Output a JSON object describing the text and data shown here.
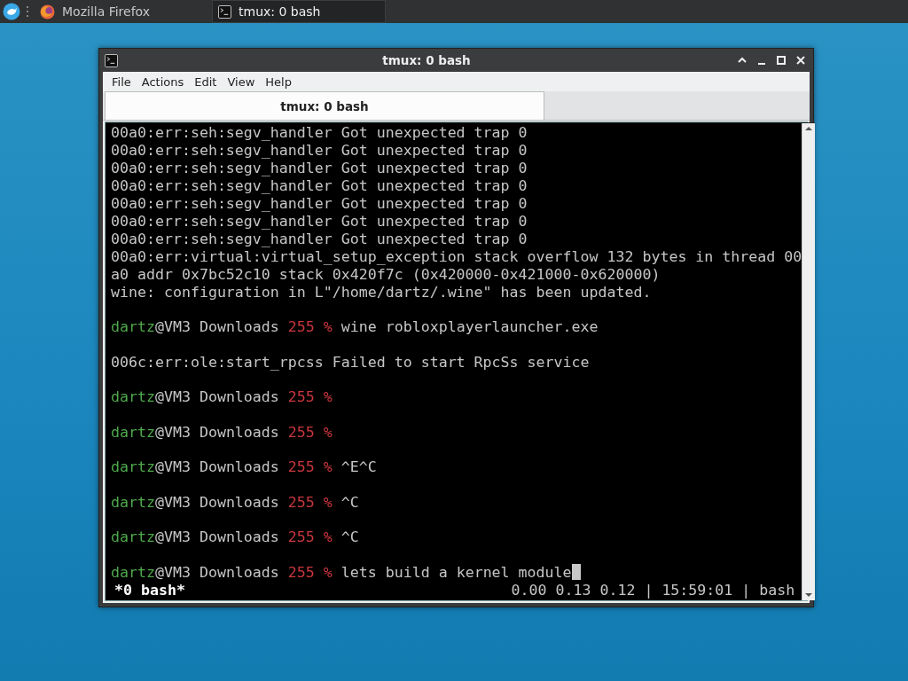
{
  "taskbar": {
    "tasks": [
      {
        "kind": "browser",
        "label": "Mozilla Firefox",
        "selected": false
      },
      {
        "kind": "terminal",
        "label": "tmux: 0 bash",
        "selected": true
      }
    ]
  },
  "window": {
    "title": "tmux: 0 bash",
    "menu": [
      "File",
      "Actions",
      "Edit",
      "View",
      "Help"
    ],
    "tabs": [
      {
        "label": "tmux: 0 bash",
        "selected": true
      }
    ],
    "terminal": {
      "lines": [
        {
          "kind": "plain",
          "text": "00a0:err:seh:segv_handler Got unexpected trap 0"
        },
        {
          "kind": "plain",
          "text": "00a0:err:seh:segv_handler Got unexpected trap 0"
        },
        {
          "kind": "plain",
          "text": "00a0:err:seh:segv_handler Got unexpected trap 0"
        },
        {
          "kind": "plain",
          "text": "00a0:err:seh:segv_handler Got unexpected trap 0"
        },
        {
          "kind": "plain",
          "text": "00a0:err:seh:segv_handler Got unexpected trap 0"
        },
        {
          "kind": "plain",
          "text": "00a0:err:seh:segv_handler Got unexpected trap 0"
        },
        {
          "kind": "plain",
          "text": "00a0:err:seh:segv_handler Got unexpected trap 0"
        },
        {
          "kind": "plain",
          "text": "00a0:err:virtual:virtual_setup_exception stack overflow 132 bytes in thread 00"
        },
        {
          "kind": "plain",
          "text": "a0 addr 0x7bc52c10 stack 0x420f7c (0x420000-0x421000-0x620000)"
        },
        {
          "kind": "plain",
          "text": "wine: configuration in L\"/home/dartz/.wine\" has been updated."
        },
        {
          "kind": "blank"
        },
        {
          "kind": "prompt",
          "user": "dartz",
          "location": "@VM3 Downloads",
          "status": "255 %",
          "command": "wine robloxplayerlauncher.exe",
          "cursor": false
        },
        {
          "kind": "blank"
        },
        {
          "kind": "plain",
          "text": "006c:err:ole:start_rpcss Failed to start RpcSs service"
        },
        {
          "kind": "blank"
        },
        {
          "kind": "prompt",
          "user": "dartz",
          "location": "@VM3 Downloads",
          "status": "255 %",
          "cursor": false
        },
        {
          "kind": "blank"
        },
        {
          "kind": "prompt",
          "user": "dartz",
          "location": "@VM3 Downloads",
          "status": "255 %",
          "cursor": false
        },
        {
          "kind": "blank"
        },
        {
          "kind": "prompt",
          "user": "dartz",
          "location": "@VM3 Downloads",
          "status": "255 %",
          "command": "^E^C",
          "cursor": false
        },
        {
          "kind": "blank"
        },
        {
          "kind": "prompt",
          "user": "dartz",
          "location": "@VM3 Downloads",
          "status": "255 %",
          "command": "^C",
          "cursor": false
        },
        {
          "kind": "blank"
        },
        {
          "kind": "prompt",
          "user": "dartz",
          "location": "@VM3 Downloads",
          "status": "255 %",
          "command": "^C",
          "cursor": false
        },
        {
          "kind": "blank"
        },
        {
          "kind": "prompt",
          "user": "dartz",
          "location": "@VM3 Downloads",
          "status": "255 %",
          "command": "lets build a kernel module",
          "cursor": true
        }
      ],
      "status_bar": {
        "session": "*0 bash*",
        "info": "0.00 0.13 0.12 | 15:59:01 | bash"
      }
    }
  }
}
